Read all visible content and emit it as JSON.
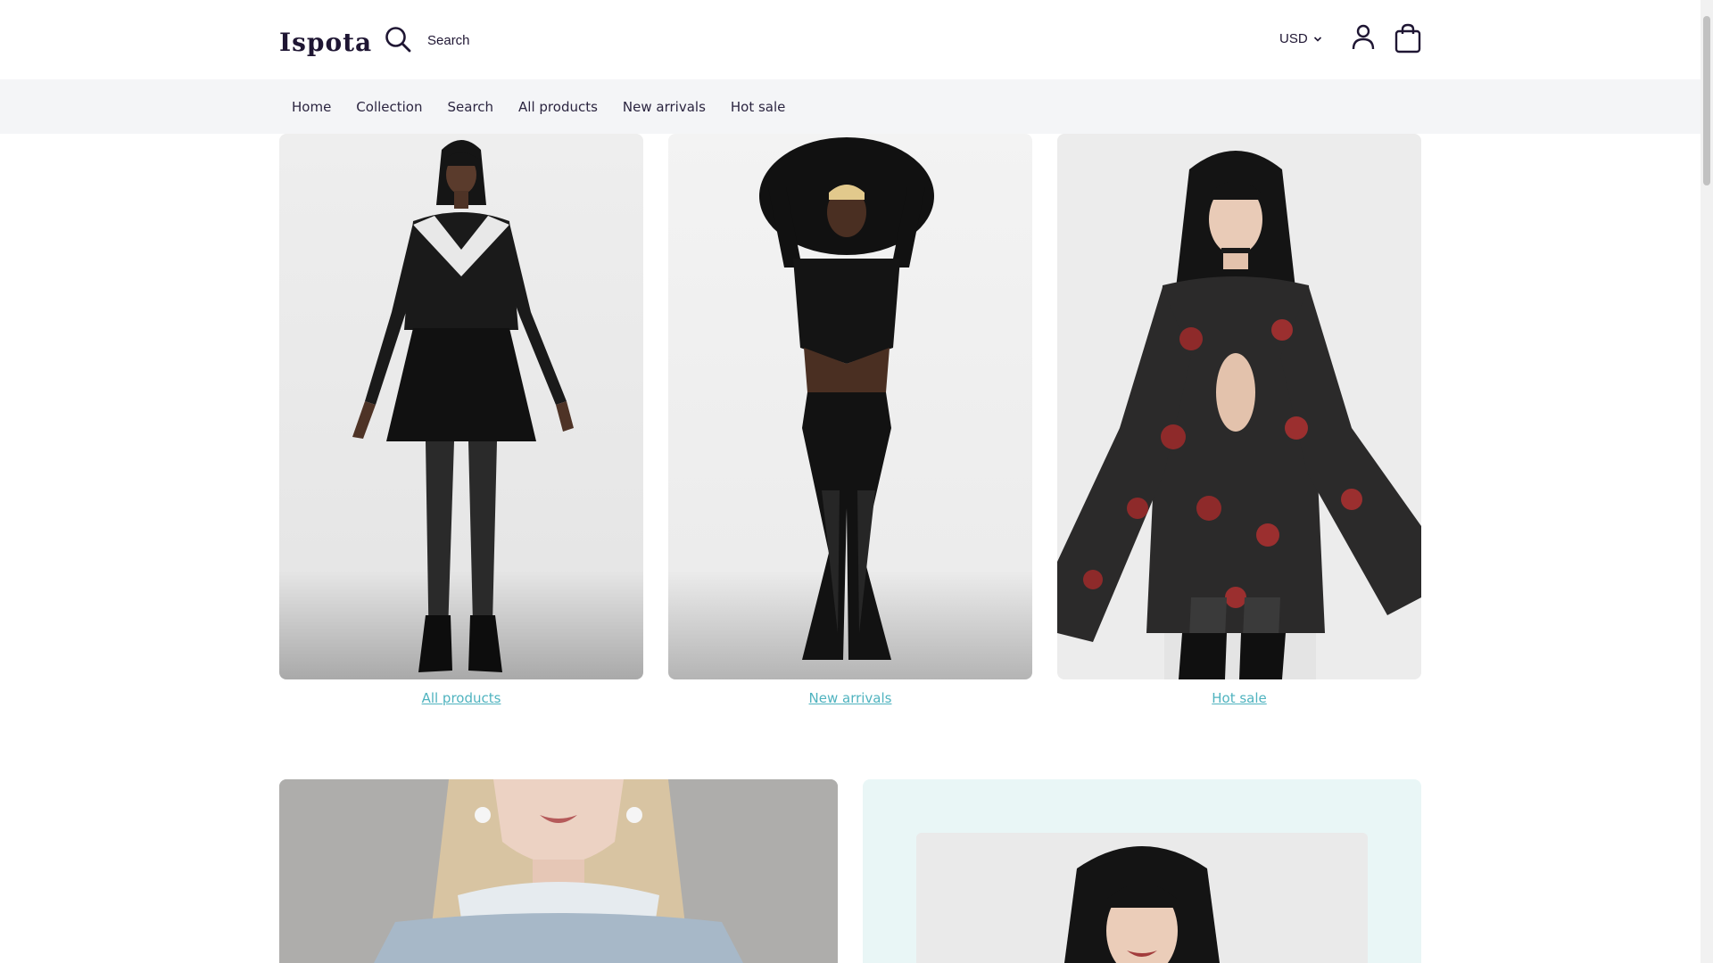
{
  "header": {
    "logo": "Ispota",
    "search_label": "Search",
    "currency": "USD",
    "icons": {
      "search": "search-icon",
      "account": "user-icon",
      "cart": "shopping-bag-icon",
      "currency_caret": "chevron-down-icon"
    }
  },
  "nav": {
    "items": [
      {
        "label": "Home"
      },
      {
        "label": "Collection"
      },
      {
        "label": "Search"
      },
      {
        "label": "All products"
      },
      {
        "label": "New arrivals"
      },
      {
        "label": "Hot sale"
      }
    ]
  },
  "collections": [
    {
      "label": "All products"
    },
    {
      "label": "New arrivals"
    },
    {
      "label": "Hot sale"
    }
  ],
  "colors": {
    "accent_link": "#4fb3bf",
    "nav_background": "#f4f5f7",
    "banner_background": "#e9f6f6",
    "text": "#1f1633"
  }
}
